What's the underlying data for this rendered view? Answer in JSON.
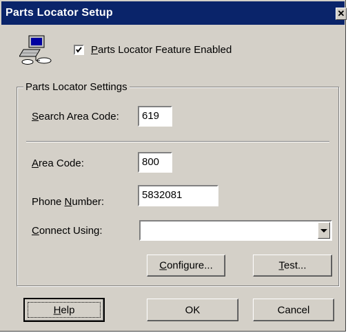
{
  "window": {
    "title": "Parts Locator Setup",
    "close_glyph": "✕"
  },
  "feature": {
    "checked": true,
    "label_prefix": "",
    "label_mnemonic": "P",
    "label_rest": "arts Locator Feature Enabled",
    "icon": "network-computer-icon"
  },
  "settings": {
    "group_label": "Parts Locator Settings",
    "search_area_code": {
      "label_mnemonic": "S",
      "label_rest": "earch Area Code:",
      "value": "619"
    },
    "area_code": {
      "label_mnemonic": "A",
      "label_rest": "rea Code:",
      "value": "800"
    },
    "phone_number": {
      "label_prefix": "Phone ",
      "label_mnemonic": "N",
      "label_rest": "umber:",
      "value": "5832081"
    },
    "connect_using": {
      "label_prefix": "",
      "label_mnemonic": "C",
      "label_rest": "onnect Using:",
      "value": ""
    },
    "configure_button": {
      "mnemonic": "C",
      "rest": "onfigure..."
    },
    "test_button": {
      "mnemonic": "T",
      "rest": "est..."
    }
  },
  "footer": {
    "help_button": {
      "mnemonic": "H",
      "rest": "elp"
    },
    "ok_button": "OK",
    "cancel_button": "Cancel"
  },
  "colors": {
    "titlebar": "#0a246a",
    "face": "#d4d0c8"
  }
}
